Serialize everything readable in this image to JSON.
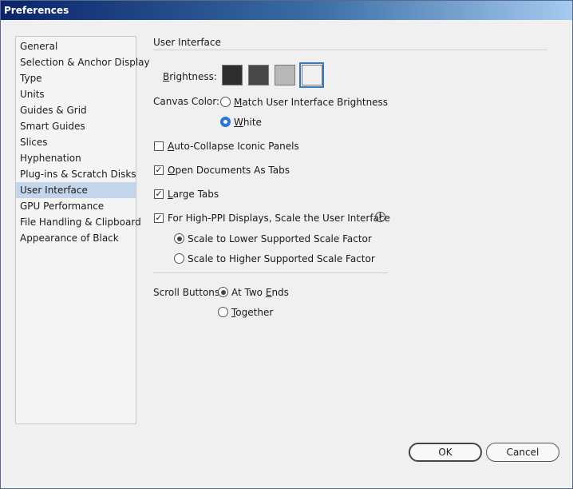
{
  "window": {
    "title": "Preferences"
  },
  "sidebar": {
    "items": [
      {
        "label": "General"
      },
      {
        "label": "Selection & Anchor Display"
      },
      {
        "label": "Type"
      },
      {
        "label": "Units"
      },
      {
        "label": "Guides & Grid"
      },
      {
        "label": "Smart Guides"
      },
      {
        "label": "Slices"
      },
      {
        "label": "Hyphenation"
      },
      {
        "label": "Plug-ins & Scratch Disks"
      },
      {
        "label": "User Interface",
        "selected": true
      },
      {
        "label": "GPU Performance"
      },
      {
        "label": "File Handling & Clipboard"
      },
      {
        "label": "Appearance of Black"
      }
    ]
  },
  "main": {
    "section_title": "User Interface",
    "brightness": {
      "label_first": "B",
      "label_rest": "rightness:",
      "swatches": [
        "#2e2e2e",
        "#474747",
        "#b8b8b8",
        "#f0f0f0"
      ],
      "selected_index": 3
    },
    "canvas_color": {
      "label": "Canvas Color:",
      "option_match": {
        "first": "M",
        "rest": "atch User Interface Brightness",
        "selected": false
      },
      "option_white": {
        "first": "W",
        "rest": "hite",
        "selected": true
      }
    },
    "auto_collapse": {
      "first": "A",
      "rest": "uto-Collapse Iconic Panels",
      "checked": false
    },
    "open_as_tabs": {
      "first": "O",
      "rest": "pen Documents As Tabs",
      "checked": true
    },
    "large_tabs": {
      "first": "L",
      "rest": "arge Tabs",
      "checked": true
    },
    "high_ppi": {
      "label": "For High-PPI Displays, Scale the User Interface",
      "checked": true,
      "option_lower": {
        "label": "Scale to Lower Supported Scale Factor",
        "selected": true
      },
      "option_higher": {
        "label": "Scale to Higher Supported Scale Factor",
        "selected": false
      }
    },
    "scroll_buttons": {
      "label": "Scroll Buttons:",
      "option_two_ends": {
        "before": "At Two ",
        "underlined": "E",
        "after": "nds",
        "selected": true
      },
      "option_together": {
        "first": "T",
        "rest": "ogether",
        "selected": false
      }
    }
  },
  "buttons": {
    "ok": "OK",
    "cancel": "Cancel"
  },
  "icons": {
    "info": "info-icon",
    "check": "✓"
  }
}
